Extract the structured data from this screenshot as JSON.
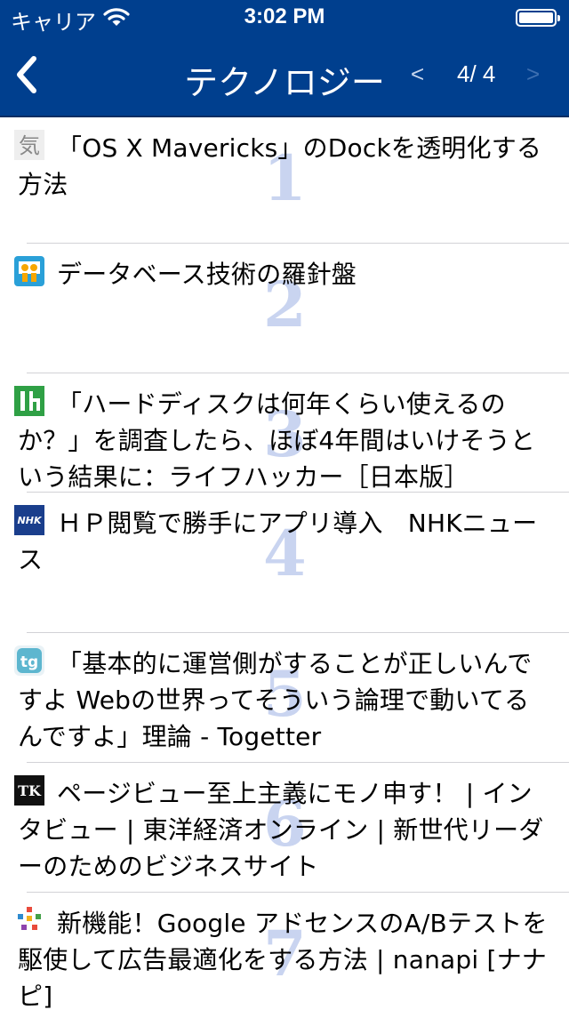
{
  "status_bar": {
    "carrier": "キャリア",
    "time": "3:02 PM"
  },
  "nav": {
    "title": "テクノロジー",
    "back_icon": "chevron-left-icon",
    "prev_label": "<",
    "page_indicator": "4/ 4",
    "next_label": ">"
  },
  "colors": {
    "header_bg": "#003f8e",
    "rank_number": "#c9d4f0",
    "separator": "#d2d2d6"
  },
  "articles": [
    {
      "rank": "1",
      "title": "「OS X Mavericks」のDockを透明化する方法",
      "favicon": "kizasi-icon"
    },
    {
      "rank": "2",
      "title": "データベース技術の羅針盤",
      "favicon": "slideshare-icon"
    },
    {
      "rank": "3",
      "title": "「ハードディスクは何年くらい使えるのか？」を調査したら、ほぼ4年間はいけそうという結果に：ライフハッカー［日本版］",
      "favicon": "lifehacker-icon"
    },
    {
      "rank": "4",
      "title": "ＨＰ閲覧で勝手にアプリ導入　NHKニュース",
      "favicon": "nhk-icon"
    },
    {
      "rank": "5",
      "title": "「基本的に運営側がすることが正しいんですよ Webの世界ってそういう論理で動いてるんですよ」理論 - Togetter",
      "favicon": "togetter-icon"
    },
    {
      "rank": "6",
      "title": "ページビュー至上主義にモノ申す！ | インタビュー | 東洋経済オンライン | 新世代リーダーのためのビジネスサイト",
      "favicon": "toyokeizai-icon"
    },
    {
      "rank": "7",
      "title": "新機能！Google アドセンスのA/Bテストを駆使して広告最適化をする方法 | nanapi [ナナピ]",
      "favicon": "nanapi-icon"
    }
  ]
}
